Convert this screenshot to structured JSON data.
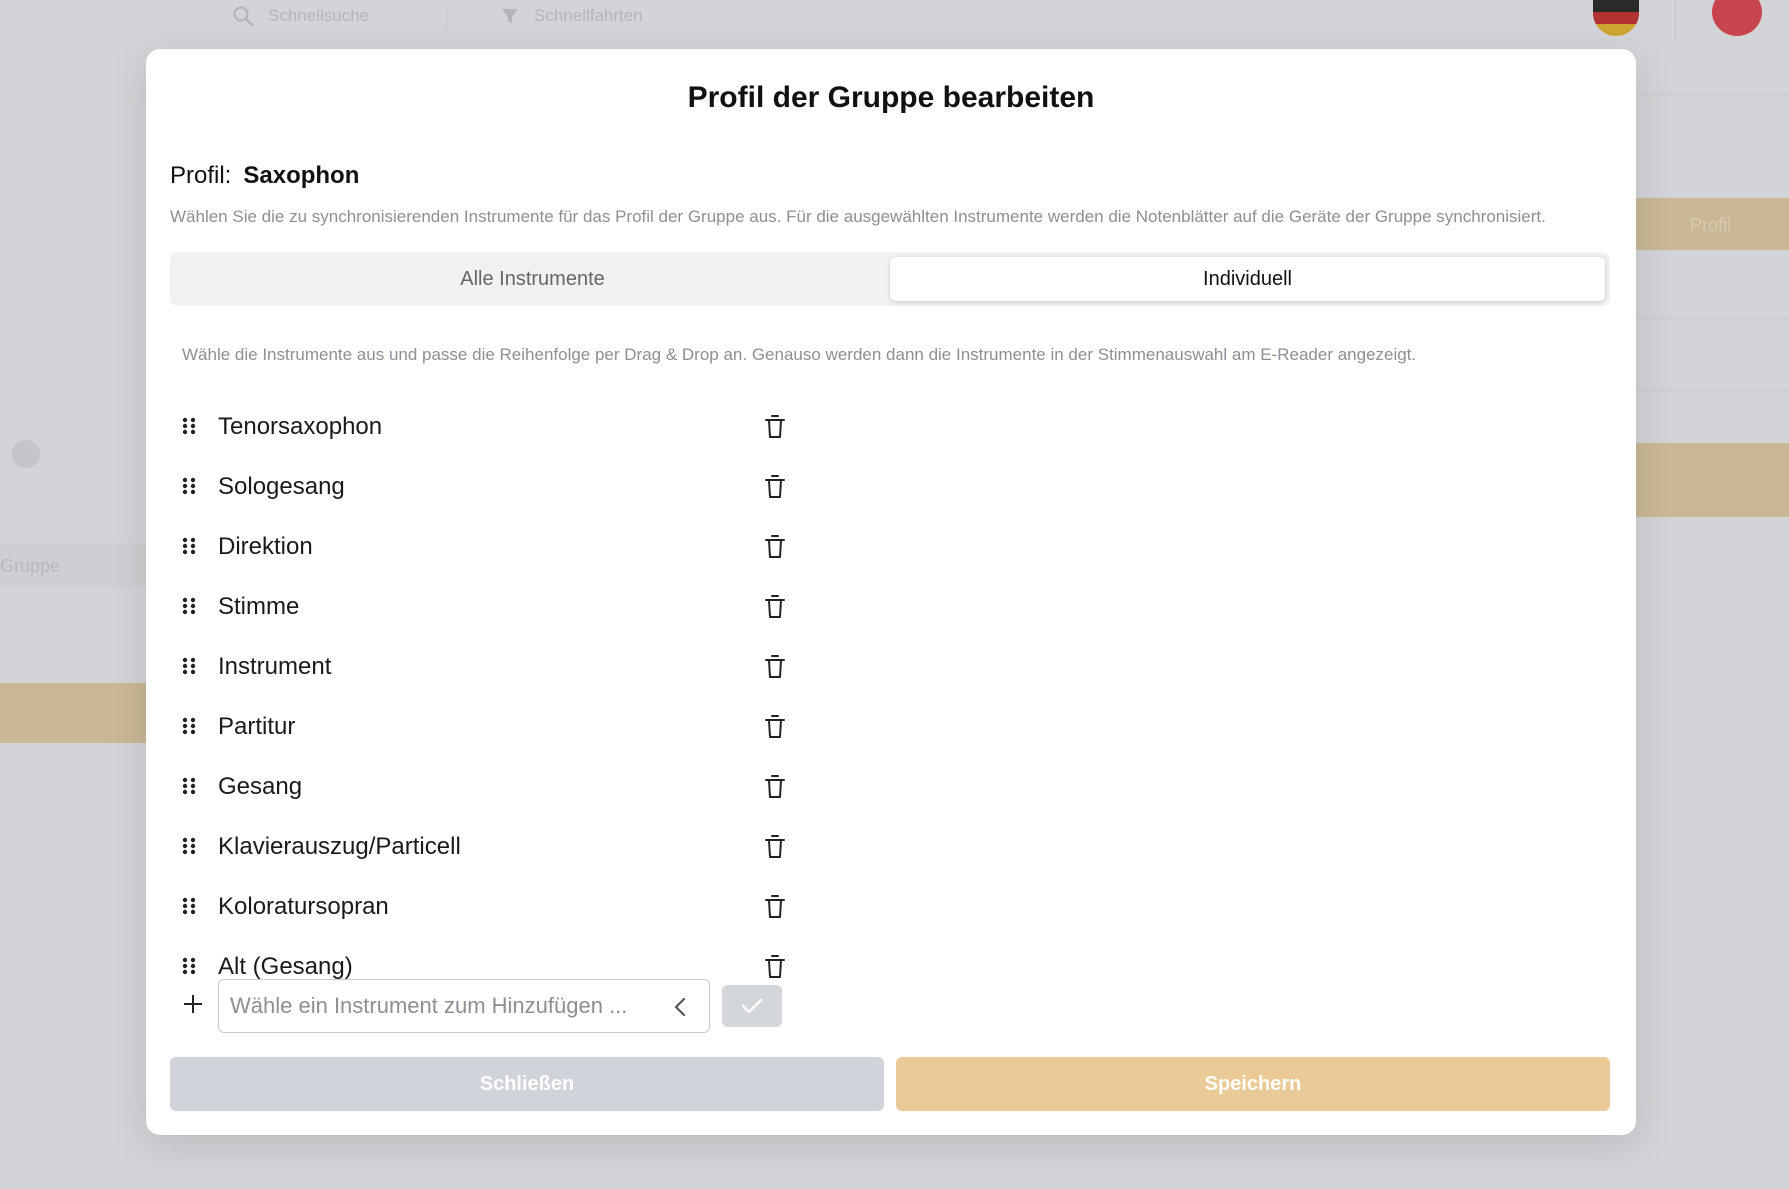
{
  "background": {
    "search_placeholder_1": "Schnellsuche",
    "search_placeholder_2": "Schnellfahrten",
    "side_text_1": "Gruppe",
    "side_text_2": "Profil"
  },
  "dialog": {
    "title": "Profil der Gruppe bearbeiten",
    "profile_label": "Profil:",
    "profile_value": "Saxophon",
    "description": "Wählen Sie die zu synchronisierenden Instrumente für das Profil der Gruppe aus. Für die ausgewählten Instrumente werden die Notenblätter auf die Geräte der Gruppe synchronisiert.",
    "tabs": [
      {
        "label": "Alle Instrumente",
        "active": false
      },
      {
        "label": "Individuell",
        "active": true
      }
    ],
    "hint": "Wähle die Instrumente aus und passe die Reihenfolge per Drag & Drop an. Genauso werden dann die Instrumente in der Stimmenauswahl am E-Reader angezeigt.",
    "instruments": [
      "Tenorsaxophon",
      "Sologesang",
      "Direktion",
      "Stimme",
      "Instrument",
      "Partitur",
      "Gesang",
      "Klavierauszug/Particell",
      "Koloratursopran",
      "Alt (Gesang)"
    ],
    "add_placeholder": "Wähle ein Instrument zum Hinzufügen ...",
    "close_label": "Schließen",
    "save_label": "Speichern"
  },
  "colors": {
    "save_button": "#eacb97",
    "close_button": "#d0d4da",
    "confirm_button": "#d3d6db"
  },
  "icons": {
    "drag": "drag-handle-icon",
    "delete": "trash-icon",
    "add": "plus-icon",
    "dropdown": "chevron-left-icon",
    "confirm": "check-icon"
  }
}
